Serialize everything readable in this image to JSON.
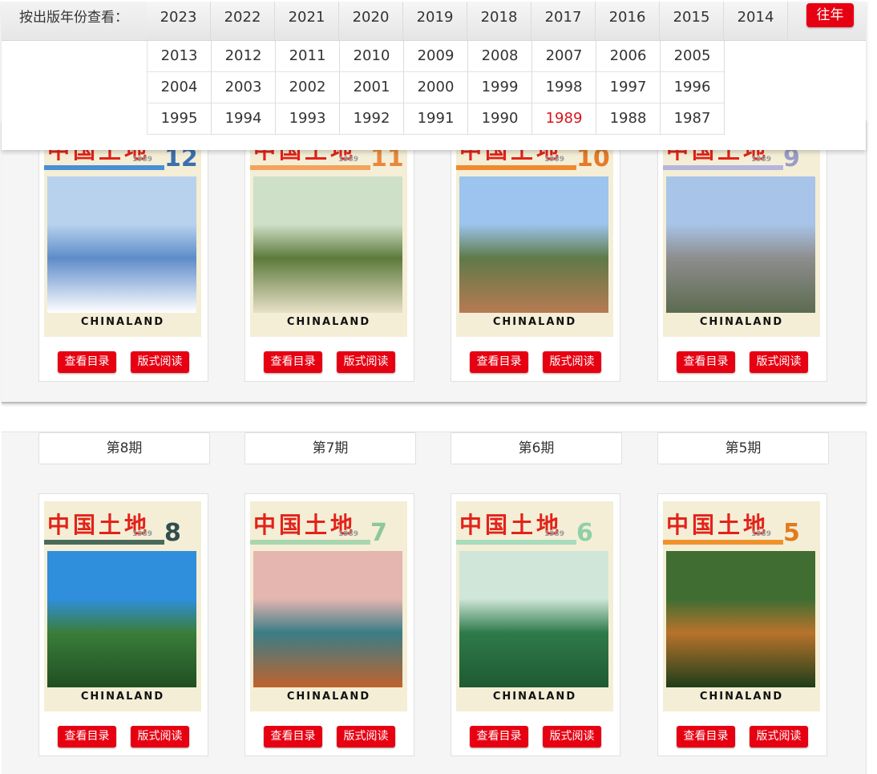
{
  "year_filter": {
    "label": "按出版年份查看：",
    "past_button": "往年",
    "active_year": "1989",
    "rows": [
      [
        "2023",
        "2022",
        "2021",
        "2020",
        "2019",
        "2018",
        "2017",
        "2016",
        "2015",
        "2014"
      ],
      [
        "2013",
        "2012",
        "2011",
        "2010",
        "2009",
        "2008",
        "2007",
        "2006",
        "2005"
      ],
      [
        "2004",
        "2003",
        "2002",
        "2001",
        "2000",
        "1999",
        "1998",
        "1997",
        "1996"
      ],
      [
        "1995",
        "1994",
        "1993",
        "1992",
        "1991",
        "1990",
        "1989",
        "1988",
        "1987"
      ]
    ]
  },
  "issues_top": [
    {
      "number": "12",
      "year": "1989",
      "title": "中国土地",
      "brand": "CHINALAND",
      "btn_toc": "查看目录",
      "btn_read": "版式阅读",
      "num_color": "#3a6fb0",
      "band": "#4a8fd6",
      "photo": [
        "#b8d2ee",
        "#5e8cc9",
        "#ffffff"
      ]
    },
    {
      "number": "11",
      "year": "1989",
      "title": "中国土地",
      "brand": "CHINALAND",
      "btn_toc": "查看目录",
      "btn_read": "版式阅读",
      "num_color": "#e9883b",
      "band": "#f2a35c",
      "photo": [
        "#cfe0c8",
        "#5d7a3b",
        "#e8e0c8"
      ]
    },
    {
      "number": "10",
      "year": "1989",
      "title": "中国土地",
      "brand": "CHINALAND",
      "btn_toc": "查看目录",
      "btn_read": "版式阅读",
      "num_color": "#e67a28",
      "band": "#f08a32",
      "photo": [
        "#9cc4ee",
        "#5f7a48",
        "#b77a52"
      ]
    },
    {
      "number": "9",
      "year": "1989",
      "title": "中国土地",
      "brand": "CHINALAND",
      "btn_toc": "查看目录",
      "btn_read": "版式阅读",
      "num_color": "#9a9cc8",
      "band": "#b4b6dc",
      "photo": [
        "#a8c4e8",
        "#8d8d8d",
        "#5c6b50"
      ]
    }
  ],
  "issues_bottom": [
    {
      "tab": "第8期",
      "number": "8",
      "year": "1989",
      "title": "中国土地",
      "brand": "CHINALAND",
      "btn_toc": "查看目录",
      "btn_read": "版式阅读",
      "num_color": "#2f4f4f",
      "band": "#4a6a5a",
      "photo": [
        "#2f8fdc",
        "#3a7d3a",
        "#1f4f22"
      ]
    },
    {
      "tab": "第7期",
      "number": "7",
      "year": "1989",
      "title": "中国土地",
      "brand": "CHINALAND",
      "btn_toc": "查看目录",
      "btn_read": "版式阅读",
      "num_color": "#8fc69a",
      "band": "#a9d6ae",
      "photo": [
        "#e5b5b0",
        "#3a7d86",
        "#c0632e"
      ]
    },
    {
      "tab": "第6期",
      "number": "6",
      "year": "1989",
      "title": "中国土地",
      "brand": "CHINALAND",
      "btn_toc": "查看目录",
      "btn_read": "版式阅读",
      "num_color": "#8fd0a8",
      "band": "#a7dcbc",
      "photo": [
        "#cfe6d8",
        "#2e7a4a",
        "#1f5a32"
      ]
    },
    {
      "tab": "第5期",
      "number": "5",
      "year": "1989",
      "title": "中国土地",
      "brand": "CHINALAND",
      "btn_toc": "查看目录",
      "btn_read": "版式阅读",
      "num_color": "#e07b1e",
      "band": "#f0922c",
      "photo": [
        "#3f6d32",
        "#b8732c",
        "#1e3d1a"
      ]
    }
  ]
}
